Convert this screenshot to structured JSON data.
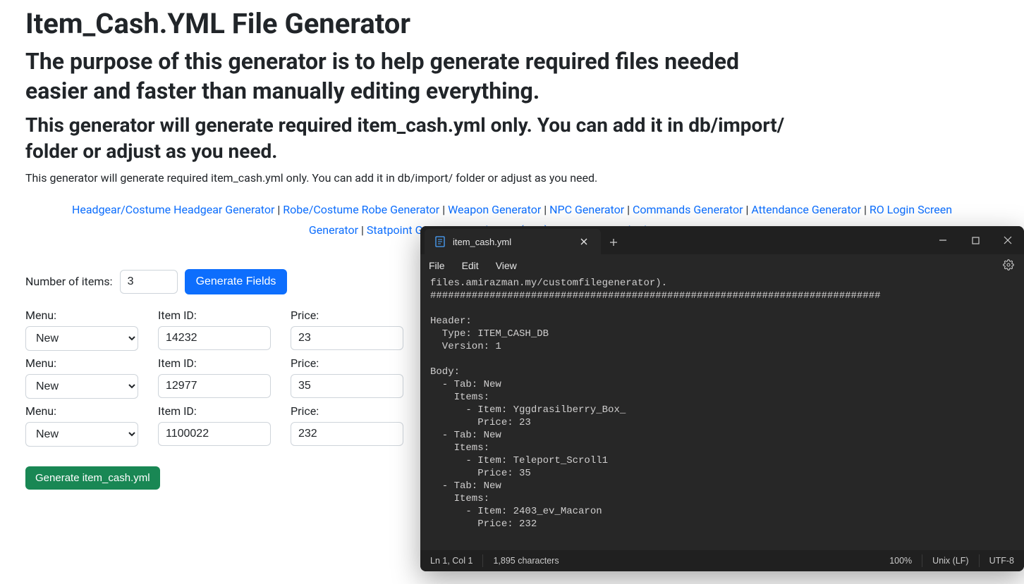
{
  "page": {
    "title": "Item_Cash.YML File Generator",
    "subtitle": "The purpose of this generator is to help generate required files needed easier and faster than manually editing everything.",
    "subtitle2": "This generator will generate required item_cash.yml only. You can add it in db/import/ folder or adjust as you need.",
    "desc": "This generator will generate required item_cash.yml only. You can add it in db/import/ folder or adjust as you need."
  },
  "nav": {
    "links": [
      "Headgear/Costume Headgear Generator",
      "Robe/Costume Robe Generator",
      "Weapon Generator",
      "NPC Generator",
      "Commands Generator",
      "Attendance Generator",
      "RO Login Screen Generator",
      "Statpoint Generator",
      "Jobstats (EXP) Generator",
      "Cash Shop Generator"
    ],
    "sep": " | "
  },
  "form": {
    "num_label": "Number of items:",
    "num_value": "3",
    "generate_fields_label": "Generate Fields",
    "menu_label": "Menu:",
    "item_label": "Item ID:",
    "price_label": "Price:",
    "menu_option": "New",
    "rows": [
      {
        "menu": "New",
        "item_id": "14232",
        "price": "23"
      },
      {
        "menu": "New",
        "item_id": "12977",
        "price": "35"
      },
      {
        "menu": "New",
        "item_id": "1100022",
        "price": "232"
      }
    ],
    "generate_file_label": "Generate item_cash.yml"
  },
  "editor": {
    "tab_title": "item_cash.yml",
    "menus": {
      "file": "File",
      "edit": "Edit",
      "view": "View"
    },
    "content": "files.amirazman.my/customfilegenerator).\n############################################################################\n\nHeader:\n  Type: ITEM_CASH_DB\n  Version: 1\n\nBody:\n  - Tab: New\n    Items:\n      - Item: Yggdrasilberry_Box_\n        Price: 23\n  - Tab: New\n    Items:\n      - Item: Teleport_Scroll1\n        Price: 35\n  - Tab: New\n    Items:\n      - Item: 2403_ev_Macaron\n        Price: 232",
    "status": {
      "pos": "Ln 1, Col 1",
      "chars": "1,895 characters",
      "zoom": "100%",
      "eol": "Unix (LF)",
      "enc": "UTF-8"
    }
  }
}
